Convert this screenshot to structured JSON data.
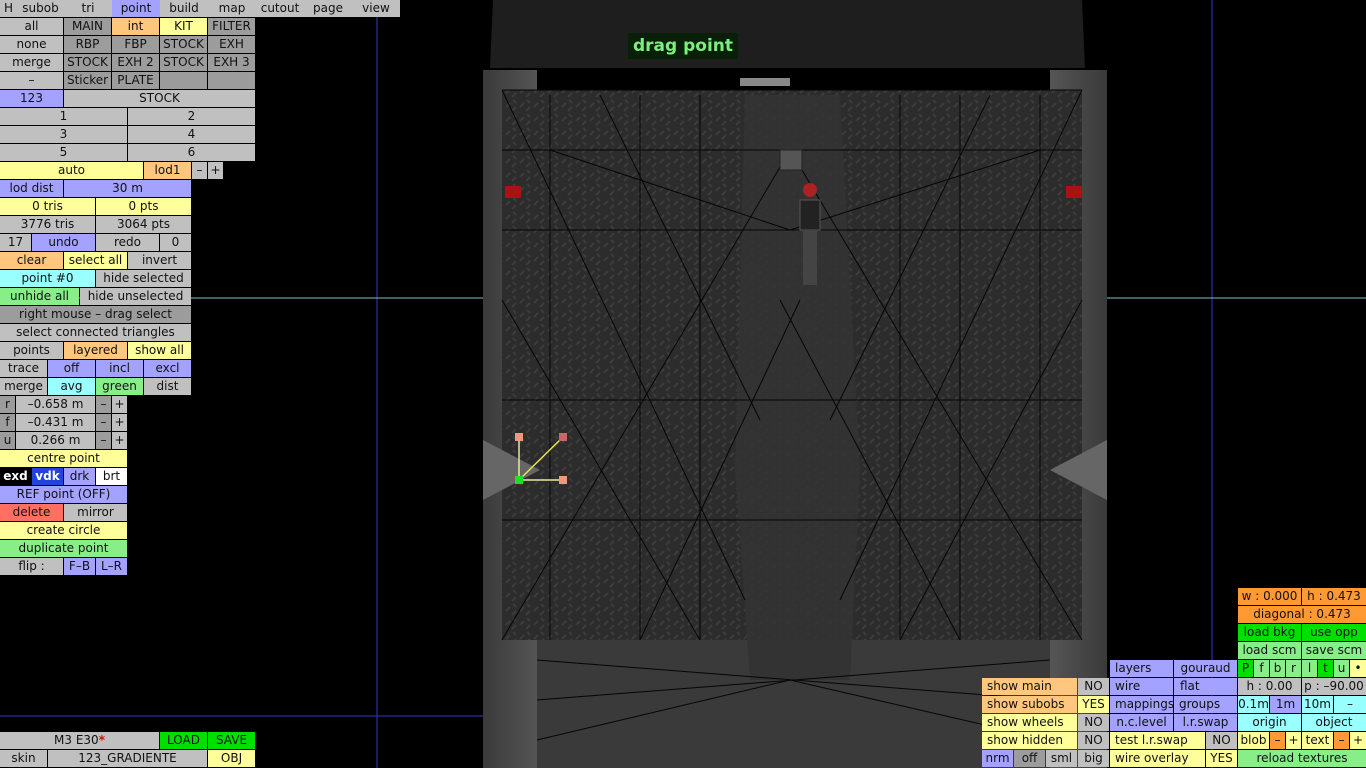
{
  "hud": {
    "drag_label": "drag point"
  },
  "tabs": [
    "H",
    "subob",
    "tri",
    "point",
    "build",
    "map",
    "cutout",
    "page",
    "view"
  ],
  "active_tab": "point",
  "palette": {
    "row1": [
      "all",
      "MAIN",
      "int",
      "KIT",
      "FILTER"
    ],
    "row2": [
      "none",
      "RBP",
      "FBP",
      "STOCK",
      "EXH"
    ],
    "row3": [
      "merge",
      "STOCK",
      "EXH 2",
      "STOCK",
      "EXH 3"
    ],
    "row4": [
      "–",
      "Sticker",
      "PLATE",
      "",
      ""
    ],
    "row5": [
      "123",
      "STOCK"
    ],
    "numbers": [
      "1",
      "2",
      "3",
      "4",
      "5",
      "6"
    ]
  },
  "lod": {
    "auto": "auto",
    "level": "lod1",
    "minus": "–",
    "plus": "+",
    "dist_label": "lod dist",
    "dist_value": "30 m"
  },
  "counts": {
    "sel_tris": "0 tris",
    "sel_pts": "0 pts",
    "tris": "3776 tris",
    "pts": "3064 pts"
  },
  "undo": {
    "count": "17",
    "undo": "undo",
    "redo": "redo",
    "redo_count": "0"
  },
  "select": {
    "clear": "clear",
    "select_all": "select all",
    "invert": "invert",
    "point_num": "point #0",
    "hide_selected": "hide selected",
    "unhide_all": "unhide all",
    "hide_unselected": "hide unselected",
    "drag_select": "right mouse – drag select",
    "connected": "select connected triangles"
  },
  "display": {
    "points": "points",
    "layered": "layered",
    "show_all": "show all"
  },
  "trace": {
    "trace": "trace",
    "off": "off",
    "incl": "incl",
    "excl": "excl"
  },
  "merge_row": {
    "merge": "merge",
    "avg": "avg",
    "green": "green",
    "dist": "dist"
  },
  "coords": [
    {
      "axis": "r",
      "value": "–0.658 m"
    },
    {
      "axis": "f",
      "value": "–0.431 m"
    },
    {
      "axis": "u",
      "value": "0.266 m"
    }
  ],
  "point_ops": {
    "centre": "centre point",
    "exd": "exd",
    "vdk": "vdk",
    "drk": "drk",
    "brt": "brt",
    "ref": "REF point (OFF)",
    "delete": "delete",
    "mirror": "mirror",
    "circle": "create circle",
    "duplicate": "duplicate point",
    "flip": "flip :",
    "fb": "F–B",
    "lr": "L–R"
  },
  "footer": {
    "car": "M3 E30",
    "star": "*",
    "load": "LOAD",
    "save": "SAVE",
    "skin": "skin",
    "skin_name": "123_GRADIENTE",
    "obj": "OBJ"
  },
  "view_panel": {
    "show_main": "show main",
    "show_main_val": "NO",
    "show_subobs": "show subobs",
    "show_subobs_val": "YES",
    "show_wheels": "show wheels",
    "show_wheels_val": "NO",
    "show_hidden": "show hidden",
    "show_hidden_val": "NO",
    "nrm": "nrm",
    "off": "off",
    "sml": "sml",
    "big": "big",
    "layers": "layers",
    "gouraud": "gouraud",
    "wire": "wire",
    "flat": "flat",
    "mappings": "mappings",
    "groups": "groups",
    "nclevel": "n.c.level",
    "lrswap": "l.r.swap",
    "test_lrswap": "test l.r.swap",
    "test_lrswap_val": "NO",
    "wire_overlay": "wire overlay",
    "wire_overlay_val": "YES"
  },
  "right_panel": {
    "w": "w : 0.000",
    "h": "h : 0.473",
    "diagonal": "diagonal : 0.473",
    "load_bkg": "load bkg",
    "use_opp": "use opp",
    "load_scm": "load scm",
    "save_scm": "save scm",
    "letters": [
      "P",
      "f",
      "b",
      "r",
      "l",
      "t",
      "u",
      "•"
    ],
    "heading": "h : 0.00",
    "pitch": "p : –90.00",
    "grid": [
      "0.1m",
      "1m",
      "10m",
      "–"
    ],
    "origin": "origin",
    "object": "object",
    "blob": "blob",
    "text": "text",
    "minus": "–",
    "plus": "+",
    "reload": "reload textures"
  }
}
